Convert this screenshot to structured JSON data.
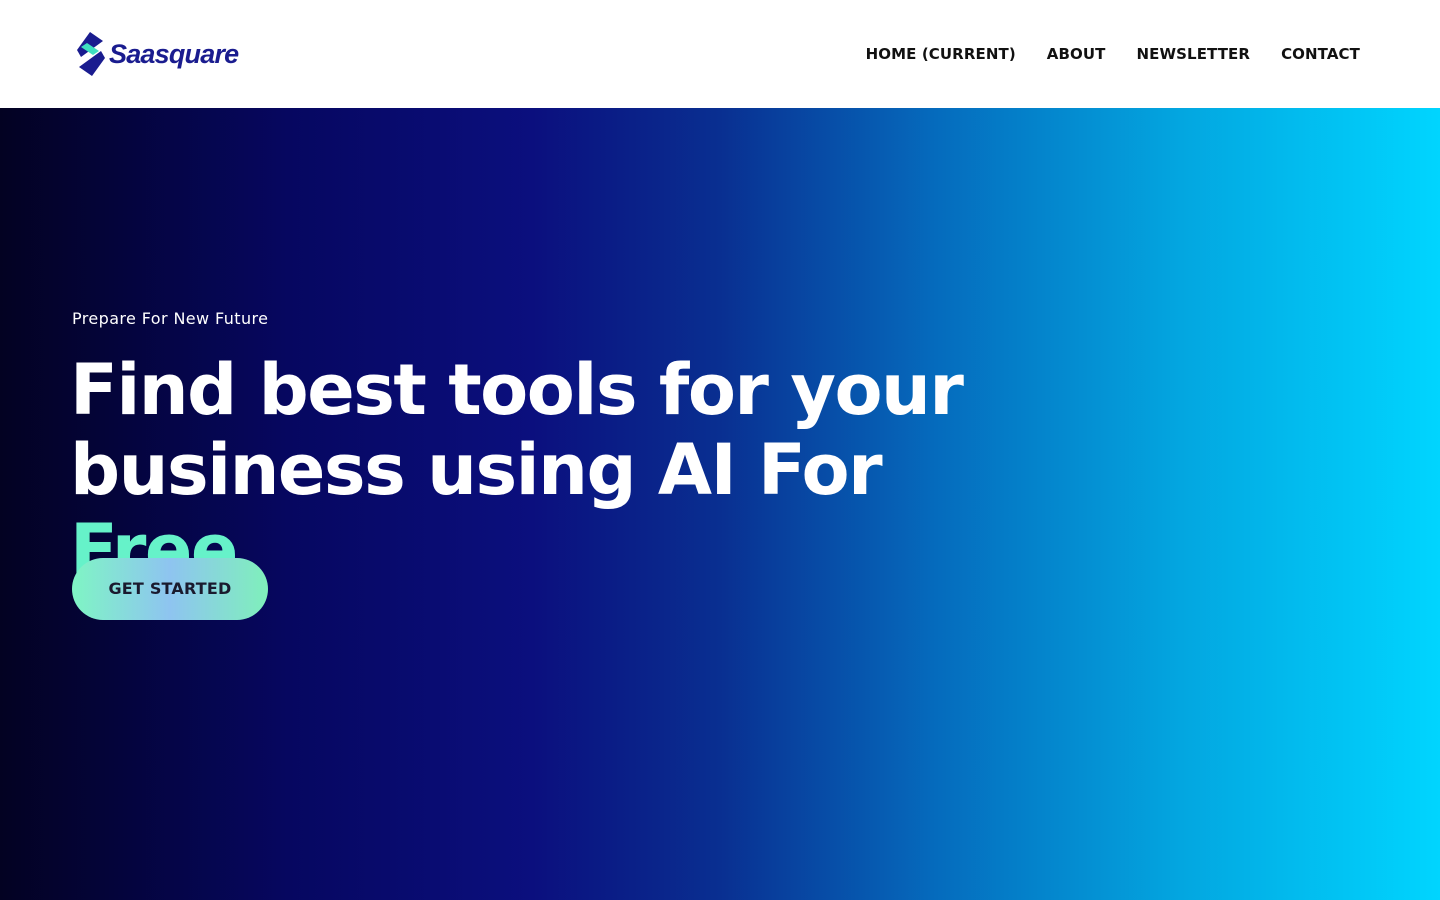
{
  "brand": {
    "name": "Saasquare",
    "logo_icon": "stacked-s-logo-icon",
    "colors": {
      "primary": "#1a1c8f",
      "accent": "#3fe0c0"
    }
  },
  "nav": {
    "items": [
      {
        "label": "HOME (CURRENT)"
      },
      {
        "label": "ABOUT"
      },
      {
        "label": "NEWSLETTER"
      },
      {
        "label": "CONTACT"
      }
    ]
  },
  "hero": {
    "eyebrow": "Prepare For New Future",
    "title_line1": "Find best tools for your",
    "title_line2_prefix": "business using AI For",
    "title_highlight": "Free",
    "cta_label": "GET STARTED",
    "colors": {
      "gradient_start": "#030222",
      "gradient_end": "#00d5ff",
      "highlight": "#66f2c9"
    }
  }
}
